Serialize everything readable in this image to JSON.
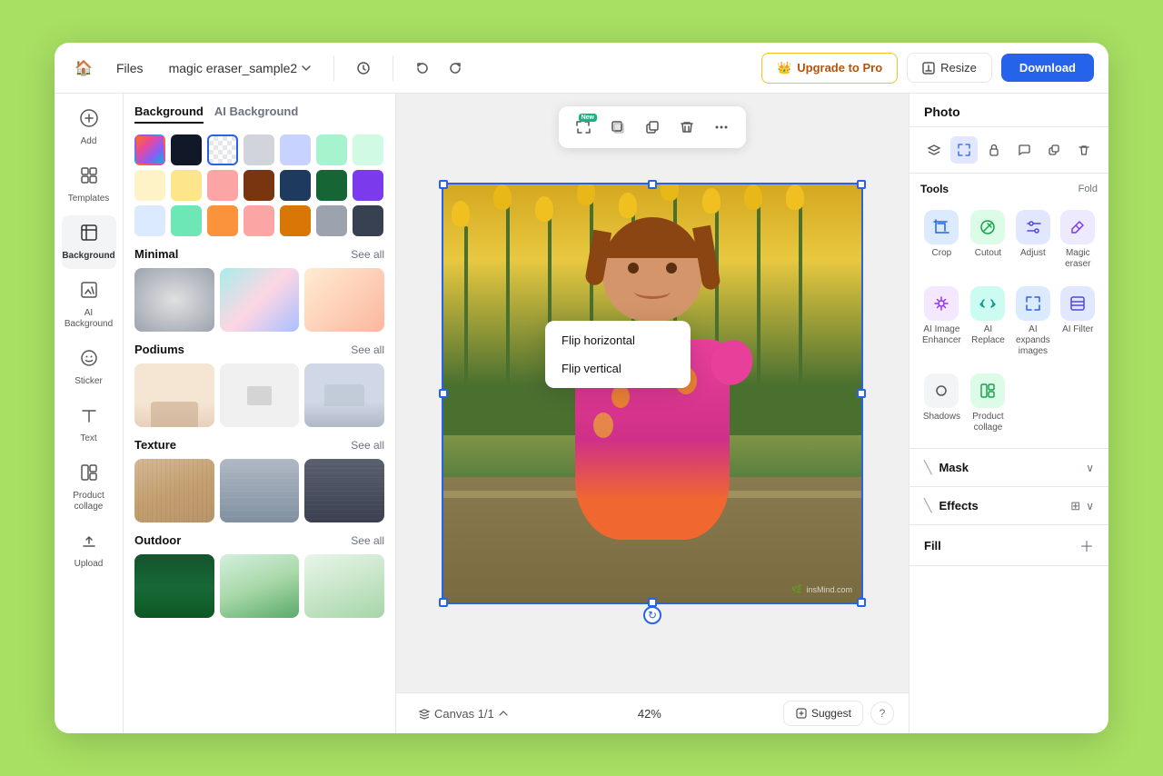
{
  "header": {
    "home_label": "🏠",
    "files_label": "Files",
    "filename": "magic eraser_sample2",
    "undo_icon": "↩",
    "redo_icon": "↪",
    "upgrade_label": "Upgrade to Pro",
    "resize_label": "Resize",
    "download_label": "Download"
  },
  "left_sidebar": {
    "items": [
      {
        "id": "add",
        "icon": "＋",
        "label": "Add"
      },
      {
        "id": "templates",
        "icon": "⊞",
        "label": "Templates"
      },
      {
        "id": "background",
        "icon": "◧",
        "label": "Background",
        "active": true
      },
      {
        "id": "ai-background",
        "icon": "✦",
        "label": "AI Background"
      },
      {
        "id": "sticker",
        "icon": "◉",
        "label": "Sticker"
      },
      {
        "id": "text",
        "icon": "T",
        "label": "Text"
      },
      {
        "id": "product-collage",
        "icon": "⊟",
        "label": "Product collage"
      },
      {
        "id": "upload",
        "icon": "↑",
        "label": "Upload"
      }
    ]
  },
  "panel": {
    "tab_background": "Background",
    "tab_ai_background": "AI Background",
    "colors": [
      {
        "type": "gradient-rainbow",
        "bg": "linear-gradient(135deg,#f97316,#ec4899,#8b5cf6,#06b6d4)"
      },
      {
        "type": "solid",
        "bg": "#111827"
      },
      {
        "type": "checkered",
        "selected": true
      },
      {
        "type": "solid",
        "bg": "#d1d5db"
      },
      {
        "type": "solid",
        "bg": "#c7d2fe"
      },
      {
        "type": "solid",
        "bg": "#a7f3d0"
      },
      {
        "type": "solid",
        "bg": "#d1fae5"
      },
      {
        "type": "solid",
        "bg": "#fef3c7"
      },
      {
        "type": "solid",
        "bg": "#fde68a"
      },
      {
        "type": "solid",
        "bg": "#fca5a5"
      },
      {
        "type": "solid",
        "bg": "#78350f"
      },
      {
        "type": "solid",
        "bg": "#1e3a5f"
      },
      {
        "type": "solid",
        "bg": "#166534"
      },
      {
        "type": "solid",
        "bg": "#7c3aed"
      },
      {
        "type": "solid",
        "bg": "#dbeafe"
      },
      {
        "type": "solid",
        "bg": "#6ee7b7"
      },
      {
        "type": "solid",
        "bg": "#fb923c"
      },
      {
        "type": "solid",
        "bg": "#fca5a5"
      },
      {
        "type": "solid",
        "bg": "#d97706"
      },
      {
        "type": "solid",
        "bg": "#9ca3af"
      },
      {
        "type": "solid",
        "bg": "#374151"
      }
    ],
    "sections": {
      "minimal": "Minimal",
      "podiums": "Podiums",
      "texture": "Texture",
      "outdoor": "Outdoor"
    },
    "see_all": "See all"
  },
  "canvas_toolbar": {
    "buttons": [
      {
        "id": "magic-expand",
        "icon": "⤢",
        "label": "magic expand",
        "badge": "New",
        "active": false
      },
      {
        "id": "shadow",
        "icon": "□",
        "label": "shadow"
      },
      {
        "id": "duplicate",
        "icon": "⊞",
        "label": "duplicate"
      },
      {
        "id": "delete",
        "icon": "🗑",
        "label": "delete"
      },
      {
        "id": "more",
        "icon": "…",
        "label": "more"
      }
    ]
  },
  "canvas": {
    "zoom": "42%",
    "canvas_label": "Canvas 1/1",
    "suggest_label": "Suggest",
    "help": "?"
  },
  "context_menu": {
    "items": [
      {
        "id": "flip-h",
        "label": "Flip horizontal"
      },
      {
        "id": "flip-v",
        "label": "Flip vertical"
      }
    ]
  },
  "right_panel": {
    "title": "Photo",
    "icons": [
      {
        "id": "layers",
        "icon": "⊞"
      },
      {
        "id": "magic-expand-rp",
        "icon": "⤢",
        "active": true
      },
      {
        "id": "lock",
        "icon": "🔒"
      },
      {
        "id": "comment",
        "icon": "✎"
      },
      {
        "id": "duplicate-rp",
        "icon": "⊟"
      },
      {
        "id": "delete-rp",
        "icon": "🗑"
      }
    ],
    "tools": {
      "title": "Tools",
      "fold": "Fold",
      "items": [
        {
          "id": "crop",
          "icon": "⌖",
          "label": "Crop",
          "color": "ti-blue"
        },
        {
          "id": "cutout",
          "icon": "✂",
          "label": "Cutout",
          "color": "ti-green"
        },
        {
          "id": "adjust",
          "icon": "⊜",
          "label": "Adjust",
          "color": "ti-indigo"
        },
        {
          "id": "magic-eraser",
          "icon": "✦",
          "label": "Magic eraser",
          "color": "ti-purple"
        },
        {
          "id": "ai-image-enhancer",
          "icon": "⬆",
          "label": "AI Image Enhancer",
          "color": "ti-violet"
        },
        {
          "id": "ai-replace",
          "icon": "↺",
          "label": "AI Replace",
          "color": "ti-teal"
        },
        {
          "id": "ai-expands",
          "icon": "⤢",
          "label": "AI expands images",
          "color": "ti-blue"
        },
        {
          "id": "ai-filter",
          "icon": "≋",
          "label": "AI Filter",
          "color": "ti-indigo"
        },
        {
          "id": "shadows",
          "icon": "◑",
          "label": "Shadows",
          "color": "ti-gray"
        },
        {
          "id": "product-collage-rp",
          "icon": "⊞",
          "label": "Product collage",
          "color": "ti-green"
        }
      ]
    },
    "mask": "Mask",
    "effects": "Effects",
    "fill": "Fill"
  }
}
